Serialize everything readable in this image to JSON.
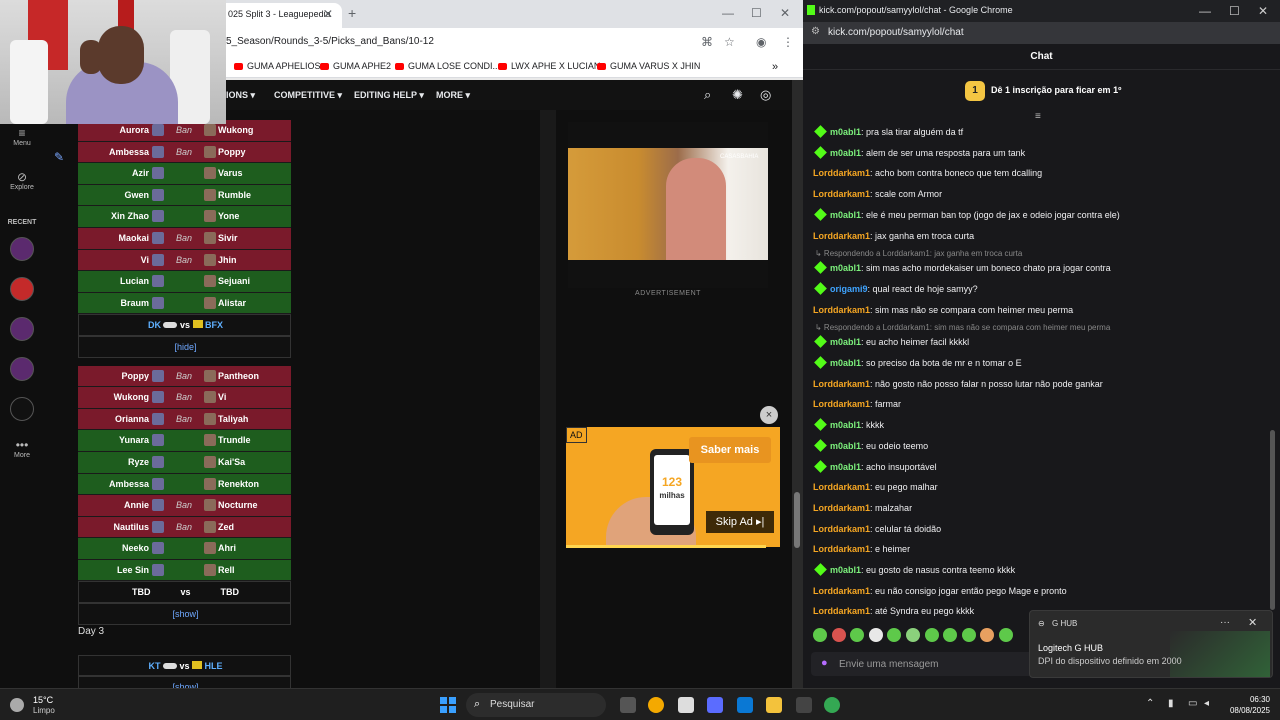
{
  "left_window": {
    "tab_title": "025 Split 3 - Leaguepedia",
    "url": "5_Season/Rounds_3-5/Picks_and_Bans/10-12",
    "bookmarks": [
      "GUMA APHELIOS",
      "GUMA APHE2",
      "GUMA LOSE CONDI...",
      "LWX APHE X LUCIAN",
      "GUMA VARUS X JHIN"
    ],
    "nav": {
      "n1": "IONS",
      "n2": "COMPETITIVE",
      "n3": "EDITING HELP",
      "n4": "MORE"
    },
    "sidebar": {
      "menu": "Menu",
      "explore": "Explore",
      "recent": "RECENT",
      "more": "More"
    },
    "ban_label": "Ban",
    "vs": "vs",
    "hide": "[hide]",
    "show": "[show]",
    "tbd": "TBD",
    "day3": "Day 3",
    "rows1": [
      {
        "left": "Aurora",
        "right": "Wukong",
        "type": "ban"
      },
      {
        "left": "Ambessa",
        "right": "Poppy",
        "type": "ban"
      },
      {
        "left": "Azir",
        "right": "Varus",
        "type": "pick"
      },
      {
        "left": "Gwen",
        "right": "Rumble",
        "type": "pick"
      },
      {
        "left": "Xin Zhao",
        "right": "Yone",
        "type": "pick"
      },
      {
        "left": "Maokai",
        "right": "Sivir",
        "type": "ban"
      },
      {
        "left": "Vi",
        "right": "Jhin",
        "type": "ban"
      },
      {
        "left": "Lucian",
        "right": "Sejuani",
        "type": "pick"
      },
      {
        "left": "Braum",
        "right": "Alistar",
        "type": "pick"
      }
    ],
    "match1": {
      "team1": "DK",
      "team2": "BFX"
    },
    "rows2": [
      {
        "left": "Poppy",
        "right": "Pantheon",
        "type": "ban"
      },
      {
        "left": "Wukong",
        "right": "Vi",
        "type": "ban"
      },
      {
        "left": "Orianna",
        "right": "Taliyah",
        "type": "ban"
      },
      {
        "left": "Yunara",
        "right": "Trundle",
        "type": "pick"
      },
      {
        "left": "Ryze",
        "right": "Kai'Sa",
        "type": "pick"
      },
      {
        "left": "Ambessa",
        "right": "Renekton",
        "type": "pick"
      },
      {
        "left": "Annie",
        "right": "Nocturne",
        "type": "ban"
      },
      {
        "left": "Nautilus",
        "right": "Zed",
        "type": "ban"
      },
      {
        "left": "Neeko",
        "right": "Ahri",
        "type": "pick"
      },
      {
        "left": "Lee Sin",
        "right": "Rell",
        "type": "pick"
      }
    ],
    "match2": {
      "team1": "KT",
      "team2": "HLE"
    },
    "video_brand": "CASASBAHIA",
    "advertisement": "ADVERTISEMENT",
    "ad": {
      "tag": "AD",
      "cta": "Saber mais",
      "skip": "Skip Ad ▸|",
      "number": "123",
      "brand": "milhas"
    }
  },
  "right_window": {
    "title": "kick.com/popout/samyylol/chat - Google Chrome",
    "url": "kick.com/popout/samyylol/chat",
    "chat_header": "Chat",
    "promo_badge": "1",
    "promo": "Dê 1 inscrição para ficar em 1º",
    "messages": [
      {
        "user": "m0abl1",
        "sep": ": ",
        "text": "pra sla tirar alguém da tf",
        "c": 1,
        "gem": true
      },
      {
        "user": "m0abl1",
        "sep": ": ",
        "text": "alem de ser uma resposta para um tank",
        "c": 1,
        "gem": true
      },
      {
        "user": "Lorddarkam1",
        "sep": ": ",
        "text": "acho bom contra boneco que tem dcalling",
        "c": 2,
        "gem": false
      },
      {
        "user": "Lorddarkam1",
        "sep": ": ",
        "text": "scale com Armor",
        "c": 2,
        "gem": false
      },
      {
        "user": "m0abl1",
        "sep": ": ",
        "text": "ele é meu perman ban top (jogo de jax e odeio jogar contra ele)",
        "c": 1,
        "gem": true
      },
      {
        "user": "Lorddarkam1",
        "sep": ": ",
        "text": "jax ganha em troca curta",
        "c": 2,
        "gem": false
      },
      {
        "reply": "↳ Respondendo a Lorddarkam1: jax ganha em troca curta"
      },
      {
        "user": "m0abl1",
        "sep": ": ",
        "text": "sim mas acho mordekaiser um boneco chato pra jogar contra",
        "c": 1,
        "gem": true
      },
      {
        "user": "origami9",
        "sep": ": ",
        "text": "qual react de hoje samyy?",
        "c": 3,
        "gem": true
      },
      {
        "user": "Lorddarkam1",
        "sep": ": ",
        "text": "sim mas não se compara com heimer meu perma",
        "c": 2,
        "gem": false
      },
      {
        "reply": "↳ Respondendo a Lorddarkam1: sim mas não se compara com heimer meu perma"
      },
      {
        "user": "m0abl1",
        "sep": ": ",
        "text": "eu acho heimer facil kkkkl",
        "c": 1,
        "gem": true
      },
      {
        "user": "m0abl1",
        "sep": ": ",
        "text": "so preciso da bota de mr e n tomar o E",
        "c": 1,
        "gem": true
      },
      {
        "user": "Lorddarkam1",
        "sep": ": ",
        "text": "não gosto não posso falar n posso lutar não pode gankar",
        "c": 2,
        "gem": false
      },
      {
        "user": "Lorddarkam1",
        "sep": ": ",
        "text": "farmar",
        "c": 2,
        "gem": false
      },
      {
        "user": "m0abl1",
        "sep": ": ",
        "text": "kkkk",
        "c": 1,
        "gem": true
      },
      {
        "user": "m0abl1",
        "sep": ": ",
        "text": "eu odeio teemo",
        "c": 1,
        "gem": true
      },
      {
        "user": "m0abl1",
        "sep": ": ",
        "text": "acho insuportável",
        "c": 1,
        "gem": true
      },
      {
        "user": "Lorddarkam1",
        "sep": ": ",
        "text": "eu pego malhar",
        "c": 2,
        "gem": false
      },
      {
        "user": "Lorddarkam1",
        "sep": ": ",
        "text": "malzahar",
        "c": 2,
        "gem": false
      },
      {
        "user": "Lorddarkam1",
        "sep": ": ",
        "text": "celular tá doidão",
        "c": 2,
        "gem": false
      },
      {
        "user": "Lorddarkam1",
        "sep": ": ",
        "text": "e heimer",
        "c": 2,
        "gem": false
      },
      {
        "user": "m0abl1",
        "sep": ": ",
        "text": "eu gosto de nasus contra teemo kkkk",
        "c": 1,
        "gem": true
      },
      {
        "user": "Lorddarkam1",
        "sep": ": ",
        "text": "eu não consigo jogar então pego Mage e pronto",
        "c": 2,
        "gem": false
      },
      {
        "user": "Lorddarkam1",
        "sep": ": ",
        "text": "até Syndra eu pego kkkk",
        "c": 2,
        "gem": false
      }
    ],
    "input_placeholder": "Envie uma mensagem"
  },
  "toast": {
    "app": "G HUB",
    "title": "Logitech G HUB",
    "body": "DPI do dispositivo definido em 2000"
  },
  "taskbar": {
    "temp": "15°C",
    "condition": "Limpo",
    "search": "Pesquisar",
    "time": "06:30",
    "date": "08/08/2025"
  }
}
